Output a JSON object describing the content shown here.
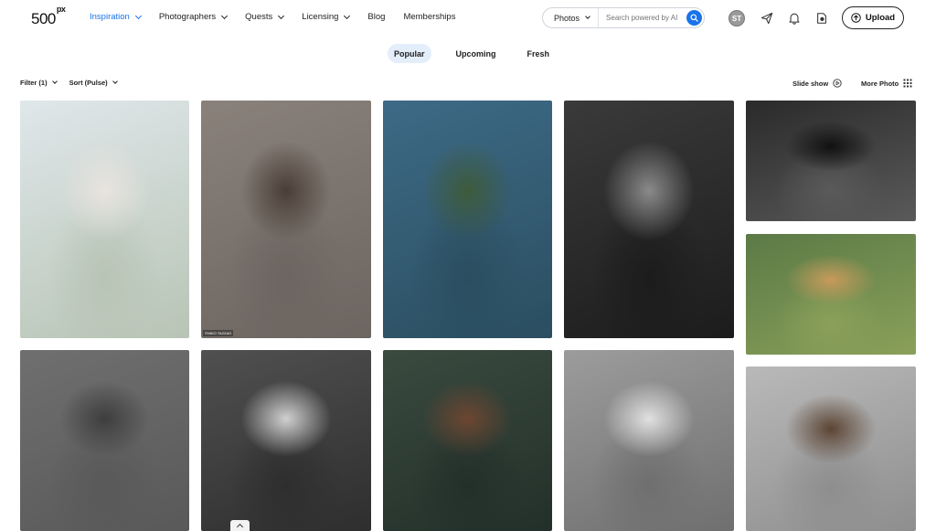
{
  "header": {
    "logo_main": "500",
    "logo_sup": "px",
    "nav": [
      {
        "label": "Inspiration",
        "dropdown": true,
        "active": true
      },
      {
        "label": "Photographers",
        "dropdown": true
      },
      {
        "label": "Quests",
        "dropdown": true
      },
      {
        "label": "Licensing",
        "dropdown": true
      },
      {
        "label": "Blog",
        "dropdown": false
      },
      {
        "label": "Memberships",
        "dropdown": false
      }
    ],
    "search": {
      "category": "Photos",
      "placeholder": "Search powered by AI"
    },
    "avatar_initials": "ST",
    "upload_label": "Upload"
  },
  "tabs": [
    {
      "label": "Popular",
      "active": true
    },
    {
      "label": "Upcoming"
    },
    {
      "label": "Fresh"
    }
  ],
  "toolbar": {
    "filter_label": "Filter (1)",
    "sort_label": "Sort (Pulse)",
    "slideshow_label": "Slide show",
    "more_photo_label": "More Photo"
  },
  "photos": [
    {
      "name": "photo-woman-white-lingerie-street",
      "colors": [
        "#dfe7ea",
        "#b8c4b5",
        "#e8e3df"
      ]
    },
    {
      "name": "photo-woman-long-hair-black-top",
      "colors": [
        "#8a817b",
        "#6c6560",
        "#4a3e37"
      ],
      "tag": "©NIKO TAZZAO"
    },
    {
      "name": "photo-woman-curly-hair-blue-jacket",
      "colors": [
        "#3d6a86",
        "#2b4e60",
        "#3e5b3b"
      ]
    },
    {
      "name": "photo-bw-woman-tattoo-arm",
      "colors": [
        "#3a3a3a",
        "#1c1c1c",
        "#8a8a8a"
      ]
    },
    {
      "name": "photo-bw-child-portrait",
      "colors": [
        "#2a2a2a",
        "#5a5a5a",
        "#111111"
      ]
    },
    {
      "name": "photo-woman-straw-hat-yellow",
      "colors": [
        "#5b7a46",
        "#8aa05a",
        "#c79a5b"
      ]
    },
    {
      "name": "photo-woman-curly-hair-gray-coat",
      "colors": [
        "#6f6f6f",
        "#595959",
        "#3e3e3e"
      ]
    },
    {
      "name": "photo-bw-woman-profile-veil",
      "colors": [
        "#505050",
        "#2e2e2e",
        "#d0d0d0"
      ]
    },
    {
      "name": "photo-woman-shell-headband",
      "colors": [
        "#3a4a3f",
        "#23302a",
        "#6d4631"
      ]
    },
    {
      "name": "photo-bw-blonde-woman-arm-raised",
      "colors": [
        "#9c9c9c",
        "#6f6f6f",
        "#e0e0e0"
      ]
    },
    {
      "name": "photo-woman-seated-gray-jacket",
      "colors": [
        "#b9b9b9",
        "#8e8e8e",
        "#5c4433"
      ]
    }
  ],
  "accent_color": "#1a73e8"
}
